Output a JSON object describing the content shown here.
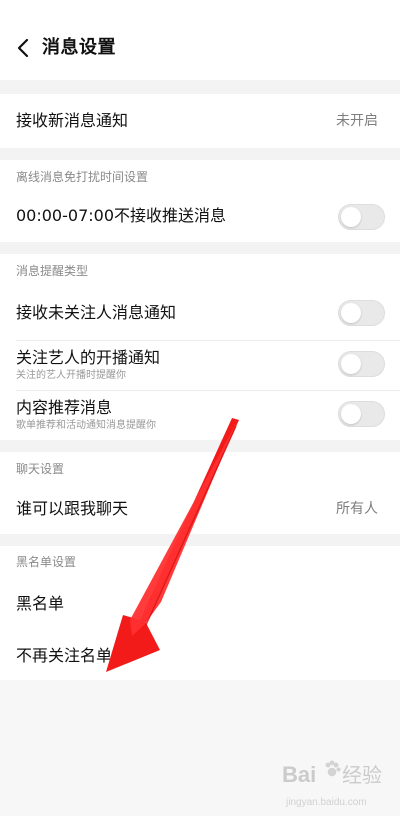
{
  "header": {
    "title": "消息设置",
    "back_icon": "chevron-left-icon"
  },
  "rows": {
    "receive_new_message": {
      "label": "接收新消息通知",
      "value": "未开启"
    },
    "offline_dnd": {
      "label": "00:00-07:00不接收推送消息",
      "toggle": "off"
    },
    "unfollowed_notice": {
      "label": "接收未关注人消息通知",
      "toggle": "off"
    },
    "artist_live": {
      "label": "关注艺人的开播通知",
      "subtext": "关注的艺人开播时提醒你",
      "toggle": "off"
    },
    "content_recommend": {
      "label": "内容推荐消息",
      "subtext": "歌单推荐和活动通知消息提醒你",
      "toggle": "off"
    },
    "who_can_chat": {
      "label": "谁可以跟我聊天",
      "value": "所有人"
    },
    "blacklist": {
      "label": "黑名单"
    },
    "unfollowed_list": {
      "label": "不再关注名单"
    }
  },
  "sections": {
    "offline_dnd_title": "离线消息免打扰时间设置",
    "reminder_type_title": "消息提醒类型",
    "chat_settings_title": "聊天设置",
    "blacklist_settings_title": "黑名单设置"
  },
  "annotation": {
    "arrow_color": "#f31a1a",
    "target": "unfollowed_list"
  },
  "watermark": {
    "icon": "baidu-paw-icon",
    "text_1": "Bai",
    "text_2": "经验",
    "text_3": "jingyan.baidu.com"
  },
  "colors": {
    "background": "#f7f7f7",
    "panel": "#ffffff",
    "primary_text": "#111111",
    "secondary_text": "#8a8a8a",
    "toggle_off": "#e9e9e9"
  }
}
